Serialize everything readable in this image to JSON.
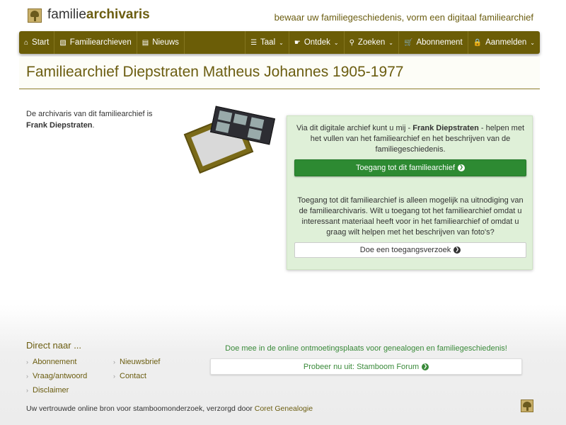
{
  "header": {
    "brand_prefix": "familie",
    "brand_bold": "archivaris",
    "tagline": "bewaar uw familiegeschiedenis, vorm een digitaal familiearchief"
  },
  "nav": {
    "left": [
      {
        "icon": "home-icon",
        "label": "Start"
      },
      {
        "icon": "book-icon",
        "label": "Familiearchieven"
      },
      {
        "icon": "newspaper-icon",
        "label": "Nieuws"
      }
    ],
    "right": [
      {
        "icon": "language-icon",
        "label": "Taal"
      },
      {
        "icon": "hand-pointer-icon",
        "label": "Ontdek"
      },
      {
        "icon": "search-icon",
        "label": "Zoeken"
      },
      {
        "icon": "cart-icon",
        "label": "Abonnement"
      },
      {
        "icon": "lock-icon",
        "label": "Aanmelden"
      }
    ]
  },
  "page": {
    "title": "Familiearchief Diepstraten Matheus Johannes 1905-1977"
  },
  "intro": {
    "text": "De archivaris van dit familiearchief is ",
    "name": "Frank Diepstraten",
    "end": "."
  },
  "panel": {
    "text1_before": "Via dit digitale archief kunt u mij - ",
    "text1_name": "Frank Diepstraten",
    "text1_after": " - helpen met het vullen van het familiearchief en het beschrijven van de familiegeschiedenis.",
    "access_button": "Toegang tot dit familiearchief",
    "text2": "Toegang tot dit familiearchief is alleen mogelijk na uitnodiging van de familiearchivaris. Wilt u toegang tot het familiearchief omdat u interessant materiaal heeft voor in het familiearchief of omdat u graag wilt helpen met het beschrijven van foto's?",
    "request_button": "Doe een toegangsverzoek"
  },
  "footer": {
    "heading": "Direct naar ...",
    "links": [
      "Abonnement",
      "Nieuwsbrief",
      "Vraag/antwoord",
      "Contact",
      "Disclaimer"
    ],
    "forum_text": "Doe mee in de online ontmoetingsplaats voor genealogen en familiegeschiedenis!",
    "forum_button": "Probeer nu uit: Stamboom Forum",
    "copyright_text": "Uw vertrouwde online bron voor stamboomonderzoek, verzorgd door ",
    "copyright_brand": "Coret Genealogie"
  },
  "colors": {
    "brand": "#6b5d07",
    "accent_green": "#2d8a32",
    "panel_bg": "#dff0d8"
  }
}
